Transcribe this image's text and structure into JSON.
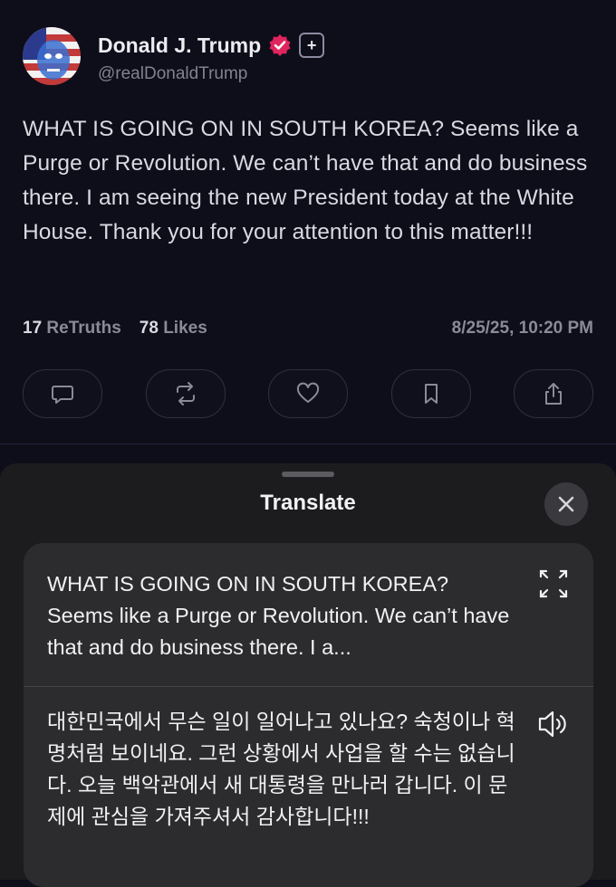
{
  "post": {
    "display_name": "Donald J. Trump",
    "handle": "@realDonaldTrump",
    "body": "WHAT IS GOING ON IN SOUTH KOREA? Seems like a Purge or Revolution. We can’t have that and do business there. I am seeing the new President today at the White House. Thank you for your attention to this matter!!!",
    "retruths_count": "17",
    "retruths_label": "ReTruths",
    "likes_count": "78",
    "likes_label": "Likes",
    "timestamp": "8/25/25, 10:20 PM",
    "verified_color": "#e0245e",
    "icons": [
      "reply-icon",
      "retruth-icon",
      "like-icon",
      "bookmark-icon",
      "share-icon"
    ]
  },
  "translate_sheet": {
    "title": "Translate",
    "source_text": "WHAT IS GOING ON IN SOUTH KOREA? Seems like a Purge or Revolution. We can’t have that and do business there. I a...",
    "translated_text": "대한민국에서 무슨 일이 일어나고 있나요? 숙청이나 혁명처럼 보이네요. 그런 상황에서 사업을 할 수는 없습니다. 오늘 백악관에서 새 대통령을 만나러 갑니다. 이 문제에 관심을 가져주셔서 감사합니다!!!",
    "icons": [
      "close-icon",
      "expand-icon",
      "speaker-icon"
    ]
  }
}
